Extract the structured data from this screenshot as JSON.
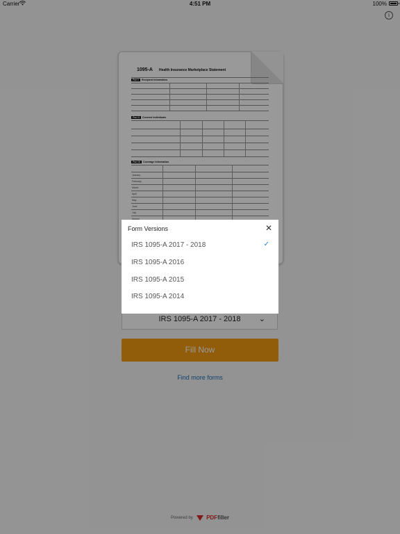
{
  "status_bar": {
    "carrier": "Carrier",
    "time": "4:51 PM",
    "battery": "100%"
  },
  "form_preview": {
    "form_number": "1095-A",
    "form_title": "Health Insurance Marketplace Statement",
    "part_1": "Part I",
    "part_1_title": "Recipient Information",
    "part_2": "Part II",
    "part_2_title": "Covered Individuals",
    "part_3": "Part III",
    "part_3_title": "Coverage Information",
    "months": [
      "January",
      "February",
      "March",
      "April",
      "May",
      "June",
      "July",
      "August"
    ]
  },
  "selector": {
    "value": "IRS 1095-A 2017 - 2018"
  },
  "fill_button": "Fill Now",
  "find_more": "Find more forms",
  "powered_by": "Powered by",
  "brand_pdf": "PDF",
  "brand_filler": "filler",
  "modal": {
    "title": "Form Versions",
    "options": [
      {
        "label": "IRS 1095-A 2017 - 2018",
        "selected": true
      },
      {
        "label": "IRS 1095-A 2016",
        "selected": false
      },
      {
        "label": "IRS 1095-A 2015",
        "selected": false
      },
      {
        "label": "IRS 1095-A 2014",
        "selected": false
      }
    ]
  },
  "colors": {
    "accent": "#f39c12",
    "link": "#1e6fb8",
    "check": "#2a7fd4",
    "brand": "#d62b2b"
  }
}
